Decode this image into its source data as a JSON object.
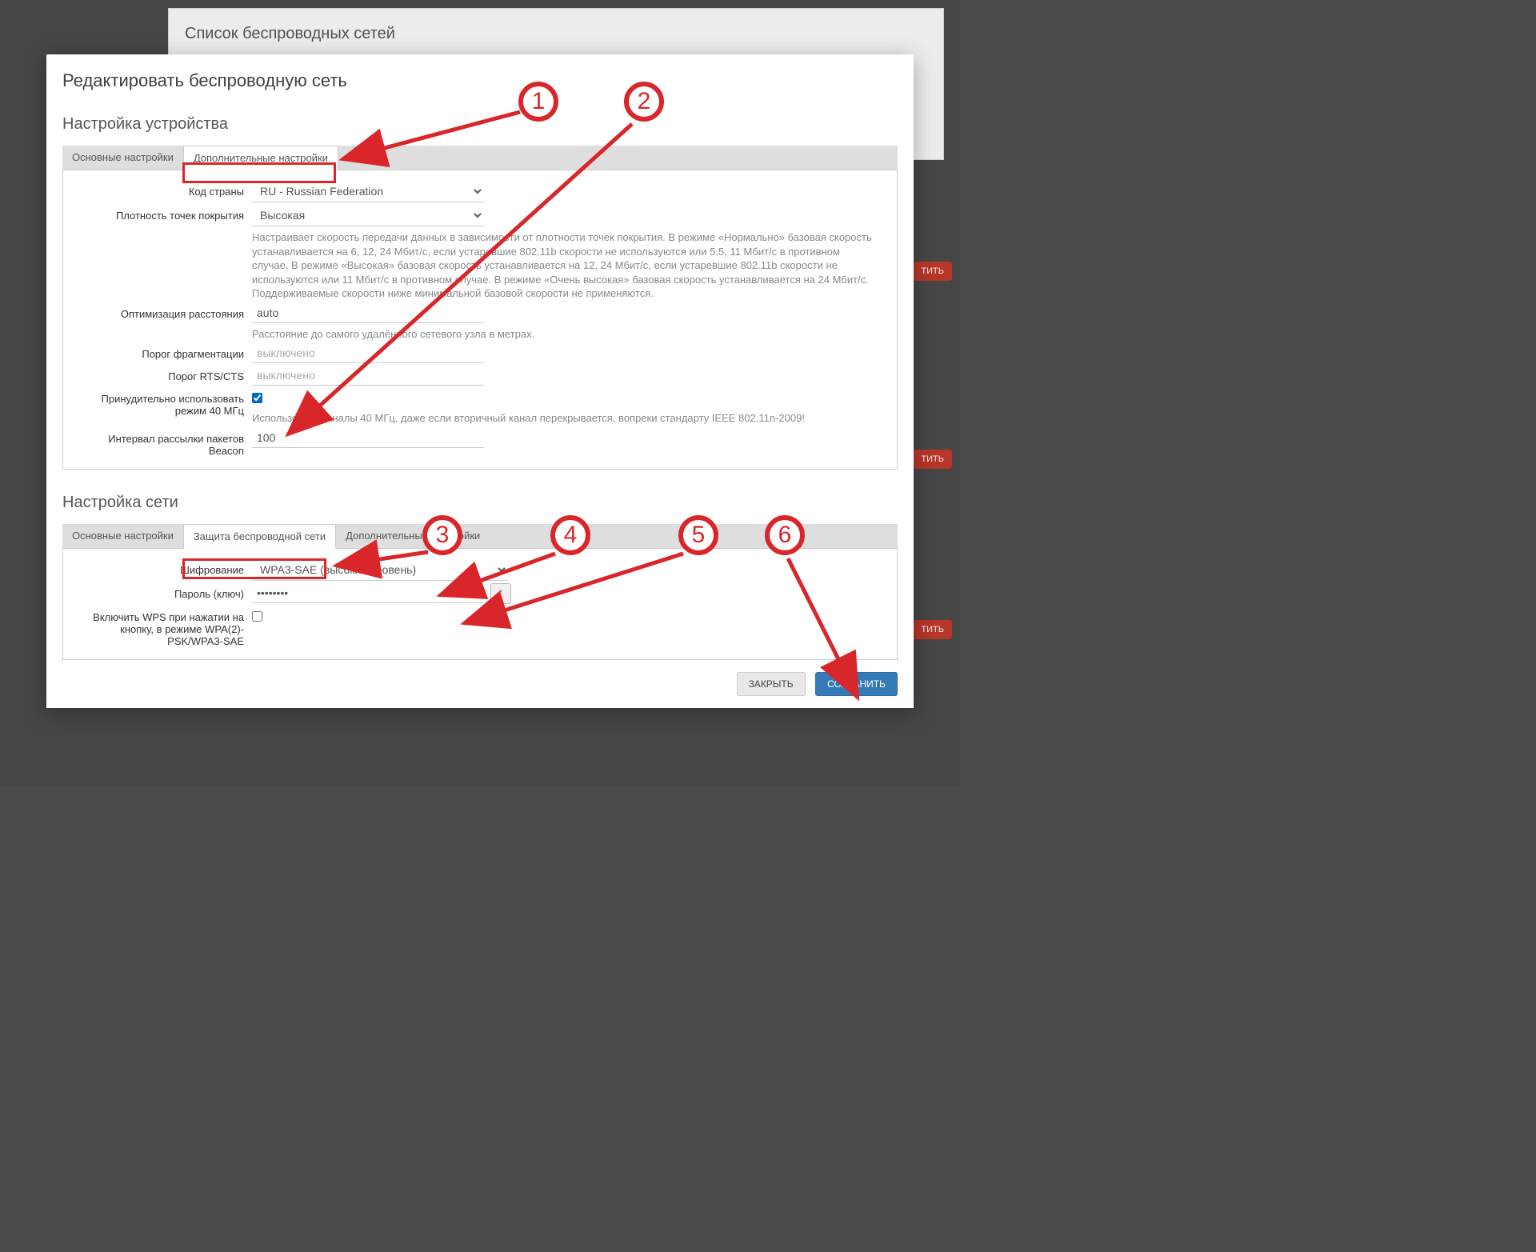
{
  "background": {
    "list_title": "Список беспроводных сетей",
    "delete_label": "ТИТЬ"
  },
  "modal": {
    "title": "Редактировать беспроводную сеть",
    "close_label": "ЗАКРЫТЬ",
    "save_label": "СОХРАНИТЬ"
  },
  "device": {
    "section_title": "Настройка устройства",
    "tab_basic": "Основные настройки",
    "tab_advanced": "Дополнительные настройки",
    "country_label": "Код страны",
    "country_value": "RU - Russian Federation",
    "density_label": "Плотность точек покрытия",
    "density_value": "Высокая",
    "density_help": "Настраивает скорость передачи данных в зависимости от плотности точек покрытия. В режиме «Нормально» базовая скорость устанавливается на 6, 12, 24 Мбит/с, если устаревшие 802.11b скорости не используются или 5.5, 11 Мбит/с в противном случае. В режиме «Высокая» базовая скорость устанавливается на 12, 24 Мбит/с, если устаревшие 802.11b скорости не используются или 11 Мбит/с в противном случае. В режиме «Очень высокая» базовая скорость устанавливается на 24 Мбит/с. Поддерживаемые скорости ниже минимальной базовой скорости не применяются.",
    "distance_label": "Оптимизация расстояния",
    "distance_value": "auto",
    "distance_help": "Расстояние до самого удалённого сетевого узла в метрах.",
    "frag_label": "Порог фрагментации",
    "frag_placeholder": "выключено",
    "rts_label": "Порог RTS/CTS",
    "rts_placeholder": "выключено",
    "force40_label": "Принудительно использовать режим 40 МГц",
    "force40_help": "Использовать каналы 40 МГц, даже если вторичный канал перекрывается, вопреки стандарту IEEE 802.11n-2009!",
    "beacon_label": "Интервал рассылки пакетов Beacon",
    "beacon_value": "100"
  },
  "network": {
    "section_title": "Настройка сети",
    "tab_basic": "Основные настройки",
    "tab_security": "Защита беспроводной сети",
    "tab_advanced": "Дополнительные настройки",
    "encryption_label": "Шифрование",
    "encryption_value": "WPA3-SAE (высокий уровень)",
    "password_label": "Пароль (ключ)",
    "password_value": "••••••••",
    "wps_label": "Включить WPS при нажатии на кнопку, в режиме WPA(2)-PSK/WPA3-SAE"
  },
  "annotations": {
    "n1": "1",
    "n2": "2",
    "n3": "3",
    "n4": "4",
    "n5": "5",
    "n6": "6"
  }
}
